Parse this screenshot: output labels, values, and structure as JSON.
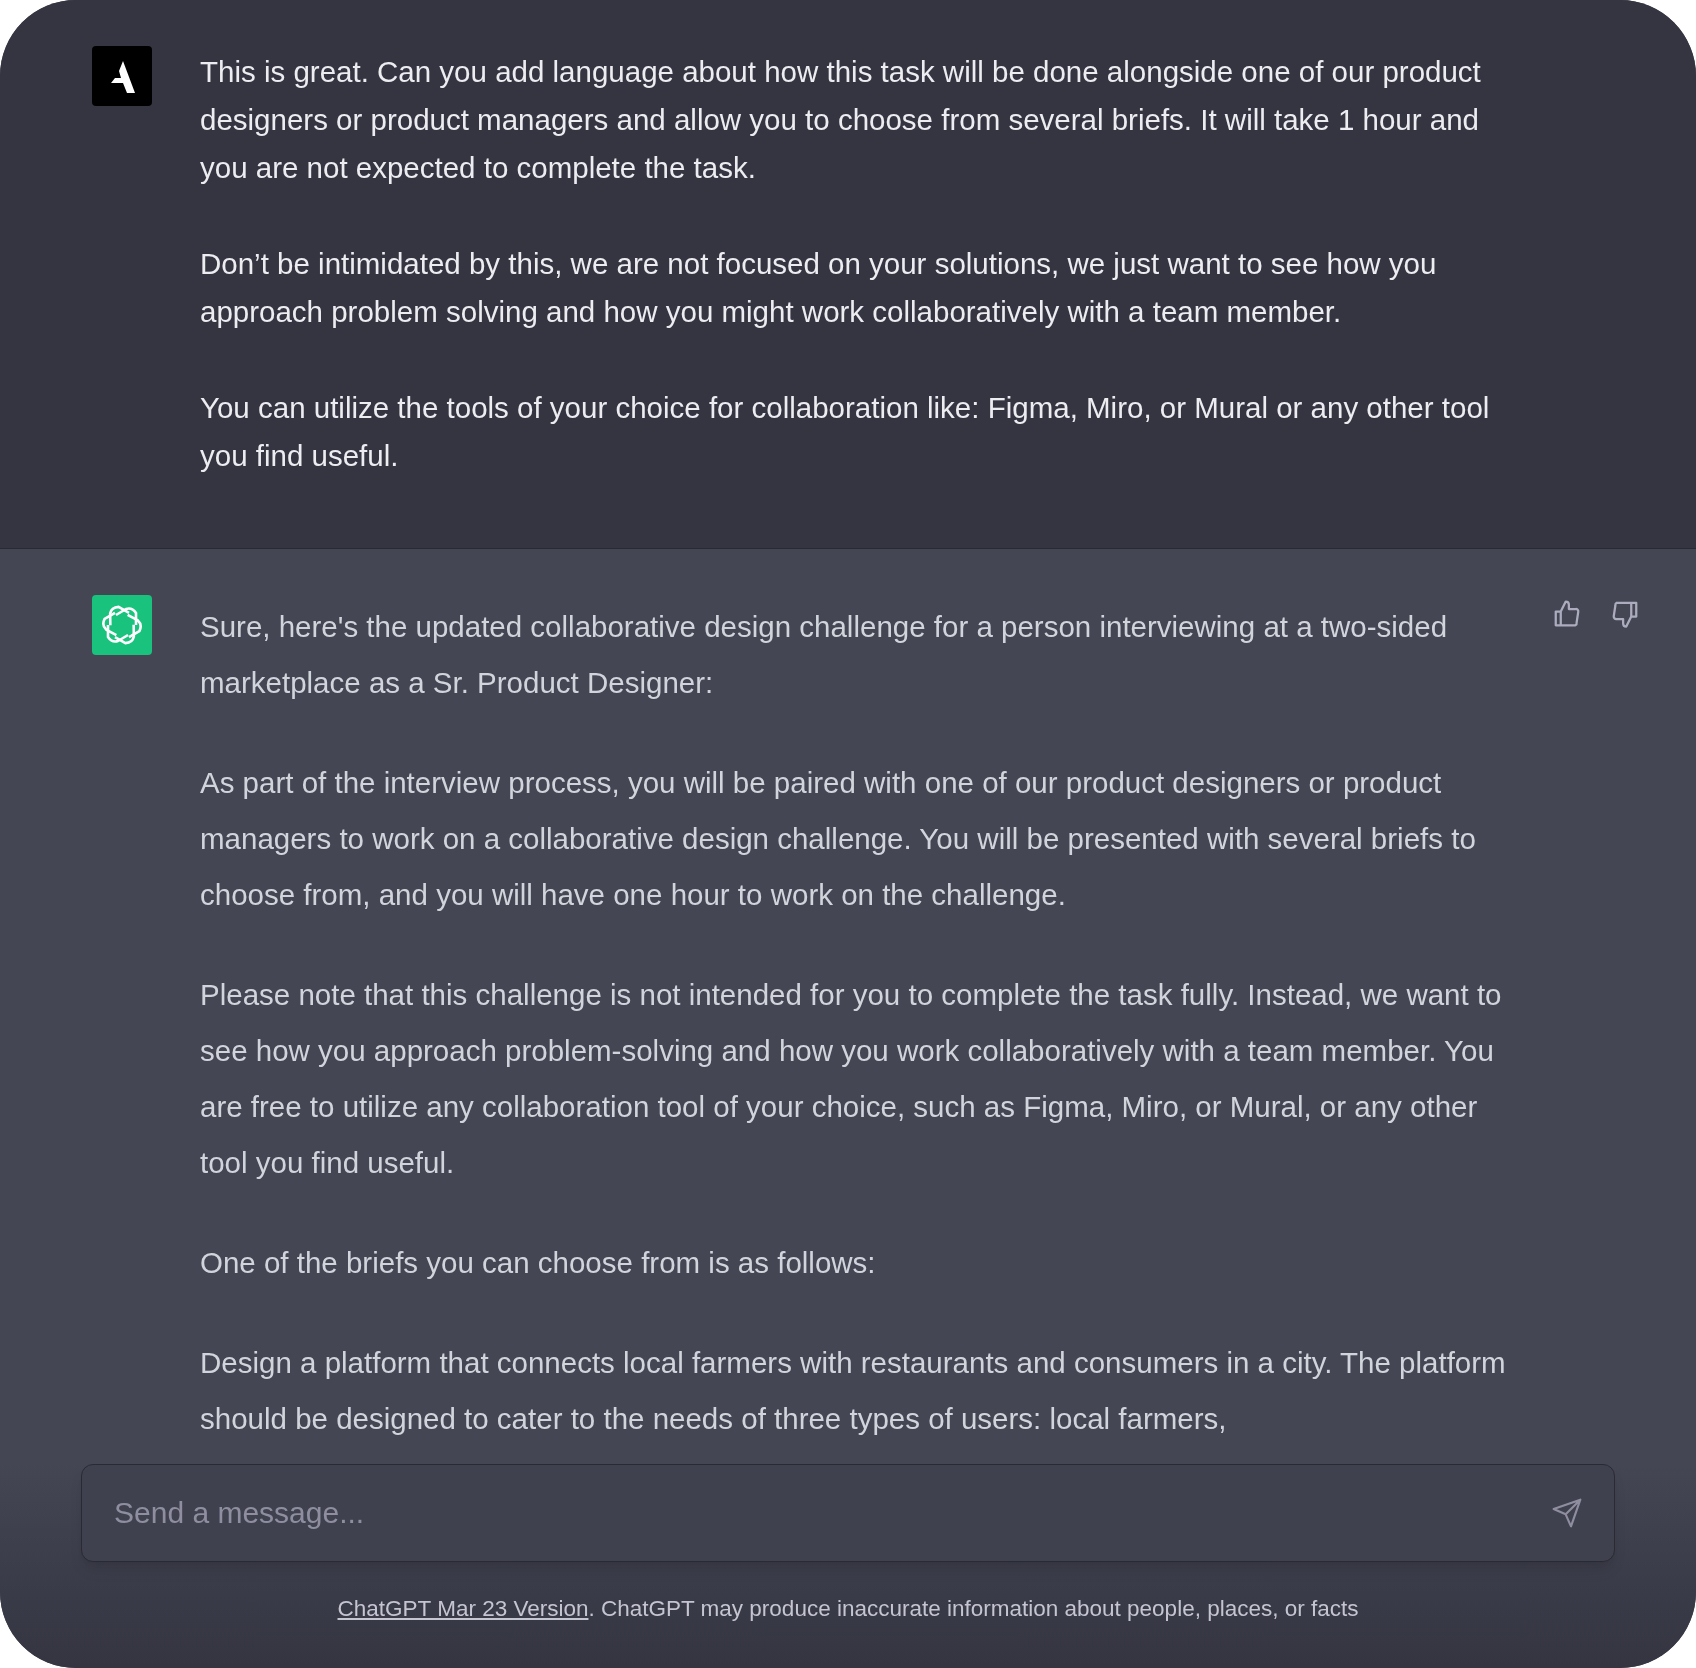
{
  "messages": [
    {
      "kind": "user",
      "paragraphs": [
        "This is great. Can you add language about how this task will be done alongside one of our product designers or product managers and allow you to choose from several briefs. It will take 1 hour and you are not expected to complete the task.",
        "Don’t be intimidated by this, we are not focused on your solutions, we just want to see how you approach problem solving and how you might work collaboratively with a team member.",
        "You can utilize the tools of your choice for collaboration like: Figma, Miro, or Mural or any other tool you find useful."
      ]
    },
    {
      "kind": "assistant",
      "feedback": true,
      "paragraphs": [
        "Sure, here's the updated collaborative design challenge for a person interviewing at a two-sided marketplace as a Sr. Product Designer:",
        "As part of the interview process, you will be paired with one of our product designers or product managers to work on a collaborative design challenge. You will be presented with several briefs to choose from, and you will have one hour to work on the challenge.",
        "Please note that this challenge is not intended for you to complete the task fully. Instead, we want to see how you approach problem-solving and how you work collaboratively with a team member. You are free to utilize any collaboration tool of your choice, such as Figma, Miro, or Mural, or any other tool you find useful.",
        "One of the briefs you can choose from is as follows:",
        "Design a platform that connects local farmers with restaurants and consumers in a city. The platform should be designed to cater to the needs of three types of users: local farmers,"
      ]
    }
  ],
  "composer": {
    "placeholder": "Send a message..."
  },
  "footer": {
    "link": "ChatGPT Mar 23 Version",
    "text": ". ChatGPT may produce inaccurate information about people, places, or facts"
  }
}
